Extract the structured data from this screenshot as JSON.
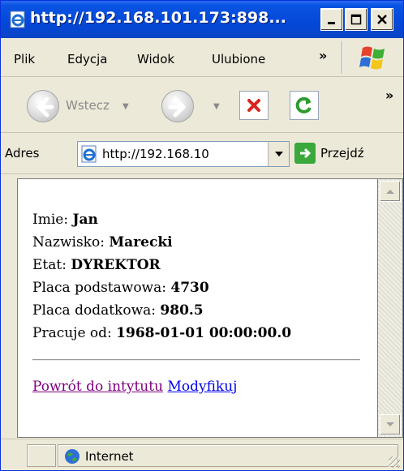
{
  "window": {
    "title": "http://192.168.101.173:898..."
  },
  "menu": {
    "items": [
      "Plik",
      "Edycja",
      "Widok",
      "Ulubione"
    ],
    "more": "»"
  },
  "toolbar": {
    "back_label": "Wstecz",
    "more": "»"
  },
  "address": {
    "label": "Adres",
    "url": "http://192.168.10",
    "go_label": "Przejdź"
  },
  "page": {
    "fields": [
      {
        "label": "Imie:",
        "value": "Jan"
      },
      {
        "label": "Nazwisko:",
        "value": "Marecki"
      },
      {
        "label": "Etat:",
        "value": "DYREKTOR"
      },
      {
        "label": "Placa podstawowa:",
        "value": "4730"
      },
      {
        "label": "Placa dodatkowa:",
        "value": "980.5"
      },
      {
        "label": "Pracuje od:",
        "value": "1968-01-01 00:00:00.0"
      }
    ],
    "links": {
      "back": "Powrót do intytutu",
      "modify": "Modyfikuj"
    }
  },
  "status": {
    "zone": "Internet"
  },
  "colors": {
    "titlebar": "#0448d8",
    "visited_link": "#800080",
    "link": "#0000ee"
  }
}
